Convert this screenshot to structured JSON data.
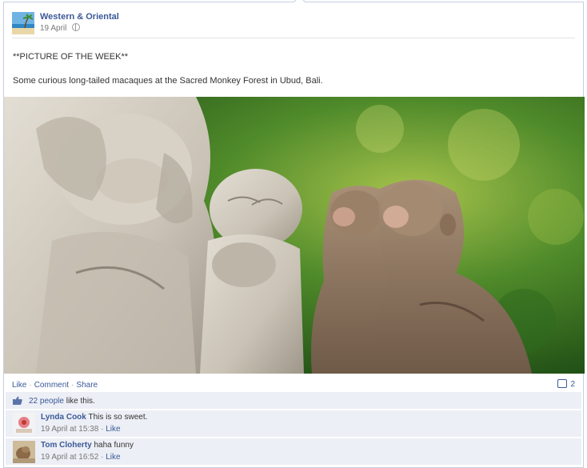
{
  "post": {
    "page_name": "Western & Oriental",
    "date": "19 April",
    "title_line": "**PICTURE OF THE WEEK**",
    "message": "Some curious long-tailed macaques at the Sacred Monkey Forest in Ubud, Bali."
  },
  "actions": {
    "like": "Like",
    "comment": "Comment",
    "share": "Share",
    "separator": "·",
    "share_count": "2"
  },
  "likes": {
    "people": "22 people",
    "suffix": " like this."
  },
  "comments": [
    {
      "author": "Lynda Cook",
      "text": "This is so sweet.",
      "time": "19 April at 15:38",
      "sep": "·",
      "like": "Like"
    },
    {
      "author": "Tom Cloherty",
      "text": "haha funny",
      "time": "19 April at 16:52",
      "sep": "·",
      "like": "Like"
    }
  ],
  "icons": [
    "globe-icon",
    "share-icon",
    "thumbs-up-icon"
  ],
  "colors": {
    "link": "#3b5998",
    "ufi_bg": "#eceff5",
    "border": "#c4cde0"
  }
}
